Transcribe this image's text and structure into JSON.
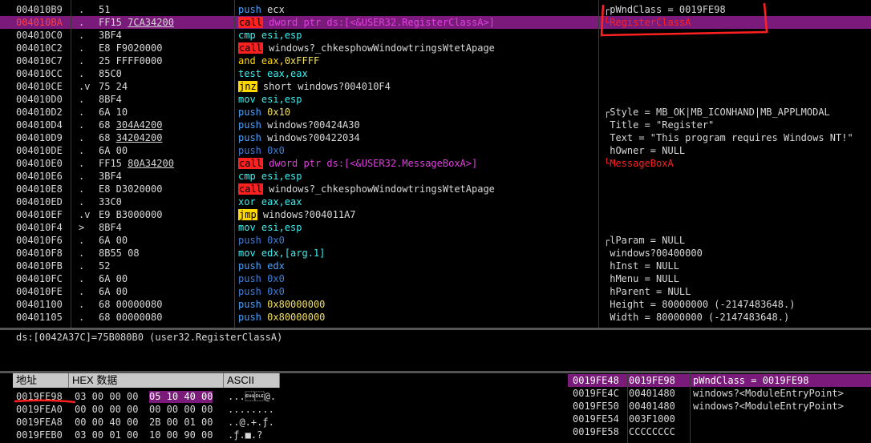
{
  "disasm": [
    {
      "addr": "004010B9",
      "mark": ".",
      "hex": "51",
      "parts": [
        [
          "c-push",
          "push"
        ],
        [
          "",
          "ecx"
        ]
      ],
      "comment": "pWndClass = 0019FE98",
      "cmcls": "",
      "cmbr": "top"
    },
    {
      "addr": "004010BA",
      "mark": ".",
      "hex": "FF15 ",
      "hexul": "7CA34200",
      "selected": true,
      "parts": [
        [
          "c-call",
          "call"
        ],
        [
          "c-ptr",
          "dword ptr ds:[<&USER32.RegisterClassA>]"
        ]
      ],
      "comment": "RegisterClassA",
      "cmcls": "cm-red",
      "cmbr": "bot"
    },
    {
      "addr": "004010C0",
      "mark": ".",
      "hex": "3BF4",
      "parts": [
        [
          "c-cmp",
          "cmp esi,esp"
        ]
      ],
      "comment": ""
    },
    {
      "addr": "004010C2",
      "mark": ".",
      "hex": "E8 F9020000",
      "parts": [
        [
          "c-call",
          "call"
        ],
        [
          "",
          "windows?_chkesphowWindowtringsWtetApage"
        ]
      ],
      "comment": ""
    },
    {
      "addr": "004010C7",
      "mark": ".",
      "hex": "25 FFFF0000",
      "parts": [
        [
          "c-and",
          "and"
        ],
        [
          "c-and",
          "eax,"
        ],
        [
          "c-imm",
          "0xFFFF"
        ]
      ],
      "comment": ""
    },
    {
      "addr": "004010CC",
      "mark": ".",
      "hex": "85C0",
      "parts": [
        [
          "c-test",
          "test eax,eax"
        ]
      ],
      "comment": ""
    },
    {
      "addr": "004010CE",
      "mark": ".v",
      "hex": "75 24",
      "parts": [
        [
          "c-jmp",
          "jnz"
        ],
        [
          "",
          "short windows?004010F4"
        ]
      ],
      "comment": ""
    },
    {
      "addr": "004010D0",
      "mark": ".",
      "hex": "8BF4",
      "parts": [
        [
          "c-mov",
          "mov esi,esp"
        ]
      ],
      "comment": ""
    },
    {
      "addr": "004010D2",
      "mark": ".",
      "hex": "6A 10",
      "parts": [
        [
          "c-push",
          "push"
        ],
        [
          "c-imm",
          "0x10"
        ]
      ],
      "comment": "Style = MB_OK|MB_ICONHAND|MB_APPLMODAL",
      "cmbr": "top"
    },
    {
      "addr": "004010D4",
      "mark": ".",
      "hex": "68 ",
      "hexul": "304A4200",
      "parts": [
        [
          "c-push",
          "push"
        ],
        [
          "",
          "windows?00424A30"
        ]
      ],
      "comment": "Title = \"Register\""
    },
    {
      "addr": "004010D9",
      "mark": ".",
      "hex": "68 ",
      "hexul": "34204200",
      "parts": [
        [
          "c-push",
          "push"
        ],
        [
          "",
          "windows?00422034"
        ]
      ],
      "comment": "Text = \"This program requires Windows NT!\""
    },
    {
      "addr": "004010DE",
      "mark": ".",
      "hex": "6A 00",
      "parts": [
        [
          "c-pushpale",
          "push"
        ],
        [
          "c-pushpale",
          "0x0"
        ]
      ],
      "comment": "hOwner = NULL"
    },
    {
      "addr": "004010E0",
      "mark": ".",
      "hex": "FF15 ",
      "hexul": "80A34200",
      "parts": [
        [
          "c-call",
          "call"
        ],
        [
          "c-ptr",
          "dword ptr ds:[<&USER32.MessageBoxA>]"
        ]
      ],
      "comment": "MessageBoxA",
      "cmcls": "cm-red",
      "cmbr": "bot"
    },
    {
      "addr": "004010E6",
      "mark": ".",
      "hex": "3BF4",
      "parts": [
        [
          "c-cmp",
          "cmp esi,esp"
        ]
      ],
      "comment": ""
    },
    {
      "addr": "004010E8",
      "mark": ".",
      "hex": "E8 D3020000",
      "parts": [
        [
          "c-call",
          "call"
        ],
        [
          "",
          "windows?_chkesphowWindowtringsWtetApage"
        ]
      ],
      "comment": ""
    },
    {
      "addr": "004010ED",
      "mark": ".",
      "hex": "33C0",
      "parts": [
        [
          "c-xor",
          "xor eax,eax"
        ]
      ],
      "comment": ""
    },
    {
      "addr": "004010EF",
      "mark": ".v",
      "hex": "E9 B3000000",
      "parts": [
        [
          "c-jmp",
          "jmp"
        ],
        [
          "",
          "windows?004011A7"
        ]
      ],
      "comment": ""
    },
    {
      "addr": "004010F4",
      "mark": ">",
      "hex": "8BF4",
      "parts": [
        [
          "c-mov",
          "mov esi,esp"
        ]
      ],
      "comment": ""
    },
    {
      "addr": "004010F6",
      "mark": ".",
      "hex": "6A 00",
      "parts": [
        [
          "c-pushpale",
          "push"
        ],
        [
          "c-pushpale",
          "0x0"
        ]
      ],
      "comment": "lParam = NULL",
      "cmbr": "top"
    },
    {
      "addr": "004010F8",
      "mark": ".",
      "hex": "8B55 08",
      "parts": [
        [
          "c-mov",
          "mov edx,[arg.1]"
        ]
      ],
      "comment": "windows?00400000"
    },
    {
      "addr": "004010FB",
      "mark": ".",
      "hex": "52",
      "parts": [
        [
          "c-push",
          "push"
        ],
        [
          "c-push",
          "edx"
        ]
      ],
      "comment": "hInst = NULL"
    },
    {
      "addr": "004010FC",
      "mark": ".",
      "hex": "6A 00",
      "parts": [
        [
          "c-pushpale",
          "push"
        ],
        [
          "c-pushpale",
          "0x0"
        ]
      ],
      "comment": "hMenu = NULL"
    },
    {
      "addr": "004010FE",
      "mark": ".",
      "hex": "6A 00",
      "parts": [
        [
          "c-pushpale",
          "push"
        ],
        [
          "c-pushpale",
          "0x0"
        ]
      ],
      "comment": "hParent = NULL"
    },
    {
      "addr": "00401100",
      "mark": ".",
      "hex": "68 00000080",
      "parts": [
        [
          "c-push",
          "push"
        ],
        [
          "c-imm",
          "0x80000000"
        ]
      ],
      "comment": "Height = 80000000 (-2147483648.)"
    },
    {
      "addr": "00401105",
      "mark": ".",
      "hex": "68 00000080",
      "parts": [
        [
          "c-push",
          "push"
        ],
        [
          "c-imm",
          "0x80000000"
        ]
      ],
      "comment": "Width = 80000000 (-2147483648.)"
    }
  ],
  "info_line": "ds:[0042A37C]=75B080B0 (user32.RegisterClassA)",
  "dump": {
    "hdr_addr": "地址",
    "hdr_hex": "HEX 数据",
    "hdr_ascii": "ASCII",
    "rows": [
      {
        "addr": "0019FE98",
        "hex1": "03 00 00 00",
        "hex2": "05 10 40 00",
        "ascii": "...\u0005\u0010@."
      },
      {
        "addr": "0019FEA0",
        "hex1": "00 00 00 00",
        "hex2": "00 00 00 00",
        "ascii": "........"
      },
      {
        "addr": "0019FEA8",
        "hex1": "00 00 40 00",
        "hex2": "2B 00 01 00",
        "ascii": "..@.+.ƒ."
      },
      {
        "addr": "0019FEB0",
        "hex1": "03 00 01 00",
        "hex2": "10 00 90 00",
        "ascii": ".ƒ.■.?"
      }
    ]
  },
  "stack": [
    {
      "addr": "0019FE48",
      "val": "0019FE98",
      "cm": "pWndClass = 0019FE98",
      "sel": true
    },
    {
      "addr": "0019FE4C",
      "val": "00401480",
      "cm": "windows?<ModuleEntryPoint>"
    },
    {
      "addr": "0019FE50",
      "val": "00401480",
      "cm": "windows?<ModuleEntryPoint>"
    },
    {
      "addr": "0019FE54",
      "val": "003F1000",
      "cm": ""
    },
    {
      "addr": "0019FE58",
      "val": "CCCCCCCC",
      "cm": ""
    }
  ],
  "colors": {
    "selection": "#7a1a7a",
    "call_bg": "#ff2020",
    "jmp_bg": "#ffd800",
    "annot": "#ff2020"
  }
}
